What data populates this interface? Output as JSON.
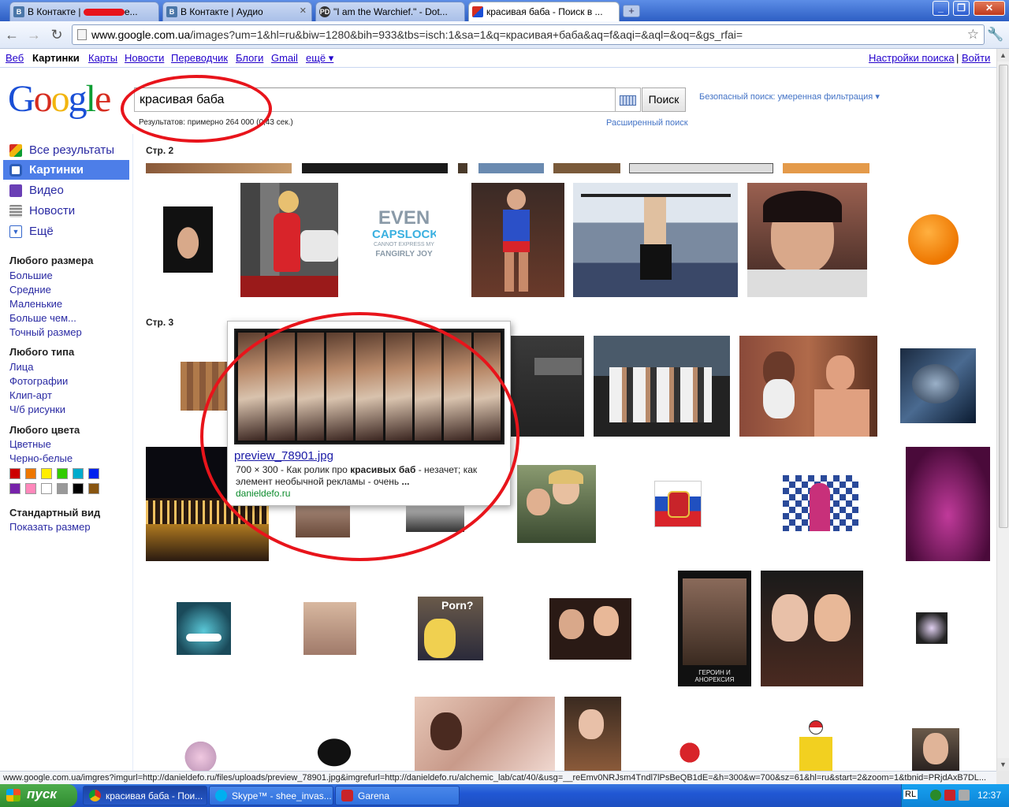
{
  "browser": {
    "tabs": [
      {
        "label": "В Контакте | ",
        "label_tail": "e...",
        "icon": "vk-icon"
      },
      {
        "label": "В Контакте | Аудио",
        "icon": "vk-icon"
      },
      {
        "label": "\"I am the Warchief.\" - Dot...",
        "icon": "playdota-icon"
      },
      {
        "label": "красивая баба - Поиск в ...",
        "icon": "google-icon",
        "active": true
      }
    ],
    "url_host": "www.google.com.ua",
    "url_path": "/images?um=1&hl=ru&biw=1280&bih=933&tbs=isch:1&sa=1&q=красивая+баба&aq=f&aqi=&aql=&oq=&gs_rfai="
  },
  "gbar": {
    "items": [
      "Веб",
      "Картинки",
      "Карты",
      "Новости",
      "Переводчик",
      "Блоги",
      "Gmail",
      "ещё ▾"
    ],
    "right": [
      "Настройки поиска",
      "|",
      "Войти"
    ]
  },
  "search": {
    "logo": [
      "G",
      "o",
      "o",
      "g",
      "l",
      "e"
    ],
    "query": "красивая баба",
    "button": "Поиск",
    "safe_search": "Безопасный поиск: умеренная фильтрация ▾",
    "stats": "Результатов: примерно 264 000 (0,43 сек.)",
    "advanced": "Расширенный поиск"
  },
  "sidebar": {
    "nav": [
      {
        "label": "Все результаты",
        "icon": "all-results-icon",
        "color": "#4a8a3a"
      },
      {
        "label": "Картинки",
        "icon": "images-icon",
        "color": "#2c5db8",
        "selected": true
      },
      {
        "label": "Видео",
        "icon": "video-icon",
        "color": "#6a3fb5"
      },
      {
        "label": "Новости",
        "icon": "news-icon",
        "color": "#888888"
      },
      {
        "label": "Ещё",
        "icon": "more-icon",
        "color": "#3366cc"
      }
    ],
    "size_heading": "Любого размера",
    "sizes": [
      "Большие",
      "Средние",
      "Маленькие",
      "Больше чем...",
      "Точный размер"
    ],
    "type_heading": "Любого типа",
    "types": [
      "Лица",
      "Фотографии",
      "Клип-арт",
      "Ч/б рисунки"
    ],
    "color_heading": "Любого цвета",
    "colors": [
      "Цветные",
      "Черно-белые"
    ],
    "swatches": [
      "#cc0000",
      "#ee7700",
      "#ffee00",
      "#33cc00",
      "#00aacc",
      "#0022ee",
      "#7722aa",
      "#ff88bb",
      "#ffffff",
      "#999999",
      "#000000",
      "#885511"
    ],
    "view_heading": "Стандартный вид",
    "view_link": "Показать размер"
  },
  "results": {
    "page2": "Стр. 2",
    "page3": "Стр. 3"
  },
  "popup": {
    "title": "preview_78901.jpg",
    "size": "700 × 300",
    "snippet_pre": " - Как ролик про ",
    "snippet_bold": "красивых баб",
    "snippet_post": " - незачет; как элемент необычной рекламы - очень ",
    "snippet_end": "...",
    "source": "danieldefo.ru"
  },
  "status_bar": "www.google.com.ua/imgres?imgurl=http://danieldefo.ru/files/uploads/preview_78901.jpg&imgrefurl=http://danieldefo.ru/alchemic_lab/cat/40/&usg=__reEmv0NRJsm4Tndl7lPsBeQB1dE=&h=300&w=700&sz=61&hl=ru&start=2&zoom=1&tbnid=PRjdAxB7DL...",
  "taskbar": {
    "start": "пуск",
    "items": [
      {
        "label": "красивая баба - Пои...",
        "icon": "chrome-icon",
        "active": true
      },
      {
        "label": "Skype™ - shee_invas...",
        "icon": "skype-icon"
      },
      {
        "label": "Garena",
        "icon": "garena-icon"
      }
    ],
    "lang": "RL",
    "clock": "12:37"
  },
  "image_texts": {
    "capslock_even": "EVEN",
    "capslock_caps": "CAPSLOCK",
    "capslock_small": "CANNOT EXPRESS MY",
    "capslock_joy": "FANGIRLY JOY",
    "porn": "Porn?",
    "anorexia": "ГЕРОИН И АНОРЕКСИЯ"
  }
}
